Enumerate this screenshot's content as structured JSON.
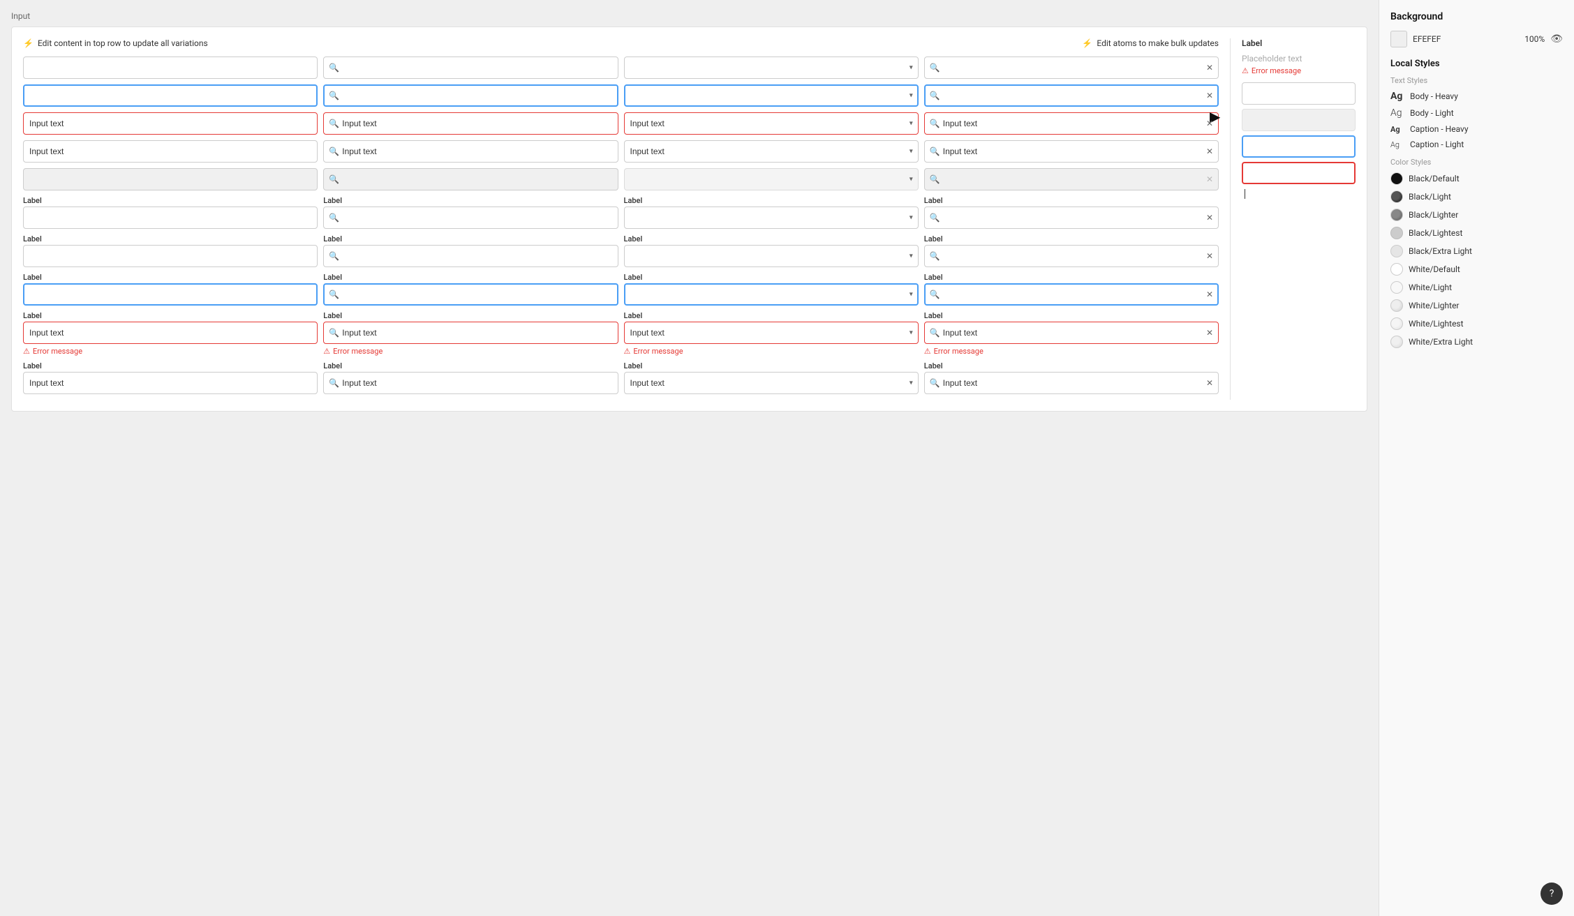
{
  "page": {
    "label": "Input",
    "edit_hint_left": "Edit content in top row to update all variations",
    "edit_hint_right": "Edit atoms to make bulk updates",
    "edit_icon": "⚡"
  },
  "rows": [
    {
      "type": "no-label",
      "cols": [
        {
          "type": "plain",
          "value": "",
          "state": "default"
        },
        {
          "type": "search",
          "value": "",
          "state": "default"
        },
        {
          "type": "select",
          "value": "",
          "state": "default"
        },
        {
          "type": "clearable",
          "value": "",
          "state": "default"
        }
      ]
    },
    {
      "type": "no-label",
      "cols": [
        {
          "type": "plain",
          "value": "",
          "state": "focused"
        },
        {
          "type": "search",
          "value": "",
          "state": "focused"
        },
        {
          "type": "select",
          "value": "",
          "state": "focused"
        },
        {
          "type": "clearable",
          "value": "",
          "state": "focused"
        }
      ]
    },
    {
      "type": "no-label",
      "cols": [
        {
          "type": "plain",
          "value": "Input text",
          "state": "error"
        },
        {
          "type": "search",
          "value": "Input text",
          "state": "error"
        },
        {
          "type": "select",
          "value": "Input text",
          "state": "error"
        },
        {
          "type": "clearable",
          "value": "Input text",
          "state": "error"
        }
      ]
    },
    {
      "type": "no-label",
      "cols": [
        {
          "type": "plain",
          "value": "Input text",
          "state": "default"
        },
        {
          "type": "search",
          "value": "Input text",
          "state": "default"
        },
        {
          "type": "select",
          "value": "Input text",
          "state": "default"
        },
        {
          "type": "clearable",
          "value": "Input text",
          "state": "default"
        }
      ]
    },
    {
      "type": "no-label",
      "cols": [
        {
          "type": "plain",
          "value": "",
          "state": "disabled"
        },
        {
          "type": "search",
          "value": "",
          "state": "disabled"
        },
        {
          "type": "select",
          "value": "",
          "state": "disabled"
        },
        {
          "type": "clearable",
          "value": "",
          "state": "disabled"
        }
      ]
    },
    {
      "type": "with-label",
      "label": "Label",
      "cols": [
        {
          "type": "plain",
          "value": "",
          "state": "default"
        },
        {
          "type": "search",
          "value": "",
          "state": "default"
        },
        {
          "type": "select",
          "value": "",
          "state": "default"
        },
        {
          "type": "clearable",
          "value": "",
          "state": "default"
        }
      ]
    },
    {
      "type": "with-label",
      "label": "Label",
      "cols": [
        {
          "type": "plain",
          "value": "",
          "state": "default"
        },
        {
          "type": "search",
          "value": "",
          "state": "default"
        },
        {
          "type": "select",
          "value": "",
          "state": "default"
        },
        {
          "type": "clearable",
          "value": "",
          "state": "default"
        }
      ]
    },
    {
      "type": "with-label",
      "label": "Label",
      "cols": [
        {
          "type": "plain",
          "value": "",
          "state": "focused"
        },
        {
          "type": "search",
          "value": "",
          "state": "focused"
        },
        {
          "type": "select",
          "value": "",
          "state": "focused"
        },
        {
          "type": "clearable",
          "value": "",
          "state": "focused"
        }
      ]
    },
    {
      "type": "with-label-error",
      "label": "Label",
      "error_msg": "Error message",
      "cols": [
        {
          "type": "plain",
          "value": "Input text",
          "state": "error"
        },
        {
          "type": "search",
          "value": "Input text",
          "state": "error"
        },
        {
          "type": "select",
          "value": "Input text",
          "state": "error"
        },
        {
          "type": "clearable",
          "value": "Input text",
          "state": "error"
        }
      ]
    },
    {
      "type": "with-label",
      "label": "Label",
      "cols": [
        {
          "type": "plain",
          "value": "Input text",
          "state": "default"
        },
        {
          "type": "search",
          "value": "Input text",
          "state": "default"
        },
        {
          "type": "select",
          "value": "Input text",
          "state": "default"
        },
        {
          "type": "clearable",
          "value": "Input text",
          "state": "default"
        }
      ]
    }
  ],
  "atom_panel": {
    "label": "Label",
    "placeholder_text": "Placeholder text",
    "error_message": "Error message"
  },
  "sidebar": {
    "background_section": "Background",
    "bg_color": "EFEFEF",
    "bg_opacity": "100%",
    "local_styles": "Local Styles",
    "text_styles_label": "Text Styles",
    "text_styles": [
      {
        "label": "Body - Heavy"
      },
      {
        "label": "Body - Light"
      },
      {
        "label": "Caption - Heavy"
      },
      {
        "label": "Caption - Light"
      }
    ],
    "color_styles_label": "Color Styles",
    "color_styles": [
      {
        "label": "Black/Default",
        "class": "black-default"
      },
      {
        "label": "Black/Light",
        "class": "black-light"
      },
      {
        "label": "Black/Lighter",
        "class": "black-lighter"
      },
      {
        "label": "Black/Lightest",
        "class": "black-lightest"
      },
      {
        "label": "Black/Extra Light",
        "class": "black-extra-light"
      },
      {
        "label": "White/Default",
        "class": "white-default"
      },
      {
        "label": "White/Light",
        "class": "white-light"
      },
      {
        "label": "White/Lighter",
        "class": "white-lighter"
      },
      {
        "label": "White/Lightest",
        "class": "white-lightest"
      },
      {
        "label": "White/Extra Light",
        "class": "white-extra-light"
      }
    ]
  }
}
